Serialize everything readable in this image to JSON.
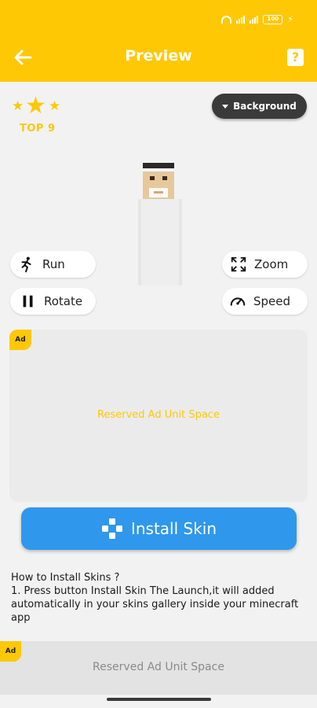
{
  "status_bar": {
    "battery": "100"
  },
  "app_bar": {
    "title": "Preview",
    "help_label": "?"
  },
  "rating": {
    "stars": 3,
    "rank_label": "TOP 9"
  },
  "background_button": {
    "label": "Background"
  },
  "controls": {
    "run_label": "Run",
    "rotate_label": "Rotate",
    "zoom_label": "Zoom",
    "speed_label": "Speed"
  },
  "ad": {
    "badge": "Ad",
    "text": "Reserved Ad Unit Space"
  },
  "install": {
    "label": "Install Skin"
  },
  "instructions": {
    "heading": "How to Install Skins ?",
    "step1": " 1. Press button Install Skin The Launch,it will added automatically in your skins gallery inside your minecraft app"
  },
  "bottom_ad": {
    "badge": "Ad",
    "text": "Reserved Ad Unit Space"
  },
  "colors": {
    "accent": "#ffc805",
    "install_button": "#2f98ed",
    "background_button": "#3a3a3a"
  }
}
